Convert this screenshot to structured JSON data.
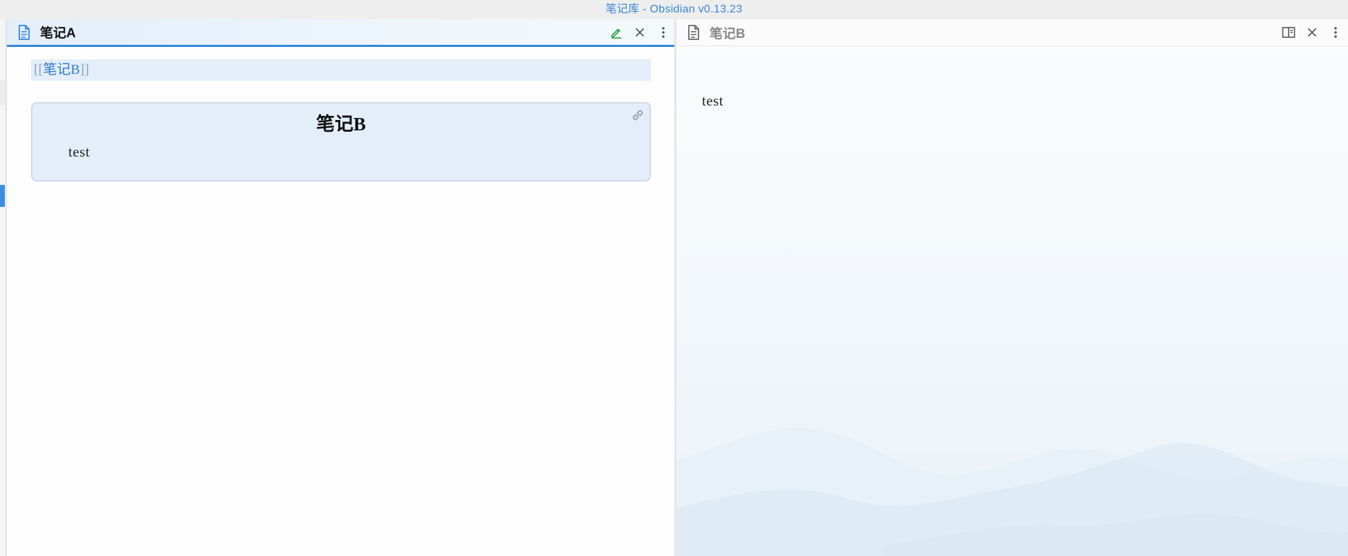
{
  "window": {
    "title": "笔记库 - Obsidian v0.13.23"
  },
  "left_pane": {
    "tab_title": "笔记A",
    "content": {
      "link_open": "[[",
      "link_text": "笔记B",
      "link_close": "]]",
      "embed": {
        "title": "笔记B",
        "body": "test"
      }
    },
    "icons": [
      "document-icon",
      "edit-pencil-icon",
      "close-icon",
      "more-options-icon"
    ],
    "colors": {
      "active_border": "#2f86d8",
      "link": "#2e7bd0",
      "edit_icon": "#27a544"
    }
  },
  "right_pane": {
    "tab_title": "笔记B",
    "content": {
      "body": "test"
    },
    "icons": [
      "document-icon",
      "reading-mode-icon",
      "close-icon",
      "more-options-icon"
    ]
  }
}
